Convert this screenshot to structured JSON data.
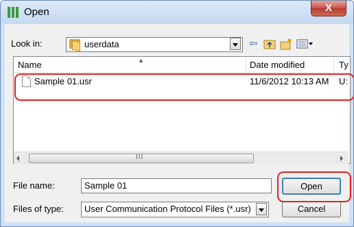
{
  "window": {
    "title": "Open",
    "close_glyph": "X"
  },
  "look_in": {
    "label": "Look in:",
    "value": "userdata"
  },
  "toolbar": {
    "icons": [
      "back-arrow-icon",
      "up-folder-icon",
      "new-folder-icon",
      "view-menu-icon"
    ]
  },
  "list": {
    "columns": {
      "name": "Name",
      "date": "Date modified",
      "type": "Ty"
    },
    "rows": [
      {
        "name": "Sample 01.usr",
        "date": "11/6/2012 10:13 AM",
        "type": "U:"
      }
    ],
    "scroll_grip": "III"
  },
  "file_name": {
    "label": "File name:",
    "value": "Sample 01"
  },
  "file_type": {
    "label": "Files of type:",
    "value": "User Communication Protocol Files (*.usr)"
  },
  "buttons": {
    "open": "Open",
    "cancel": "Cancel"
  },
  "colors": {
    "highlight": "#e02020",
    "titlebar": "#c6d9f0",
    "close_button": "#c75050"
  }
}
